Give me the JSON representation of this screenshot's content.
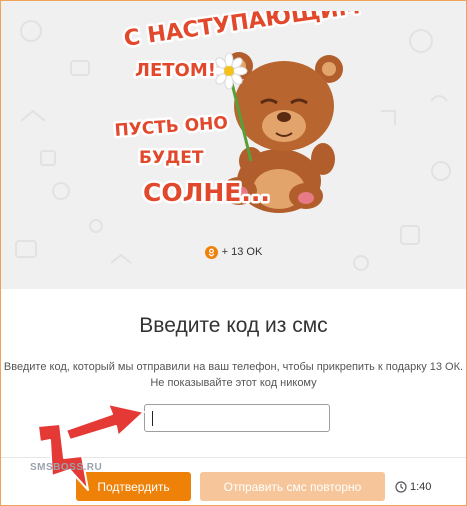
{
  "gift": {
    "sticker_lines": [
      "С НАСТУПАЮЩИМ",
      "ЛЕТОМ!",
      "ПУСТЬ ОНО",
      "БУДЕТ",
      "СОЛНЕ..."
    ],
    "price_text": "+ 13 OK",
    "coin_icon": "ok-coin-icon"
  },
  "dialog": {
    "title": "Введите код из смс",
    "description_line1": "Введите код, который мы отправили на ваш телефон, чтобы прикрепить к подарку 13 ОК.",
    "description_line2": "Не показывайте этот код никому",
    "code_value": ""
  },
  "actions": {
    "confirm_label": "Подтвердить",
    "resend_label": "Отправить смс повторно",
    "timer": "1:40",
    "timer_icon": "clock-icon"
  },
  "overlay": {
    "watermark": "SMSBOSS.RU"
  },
  "colors": {
    "accent": "#ee8208",
    "accent_disabled": "#f6c59a",
    "arrow": "#e53935",
    "border": "#f0a15a"
  }
}
